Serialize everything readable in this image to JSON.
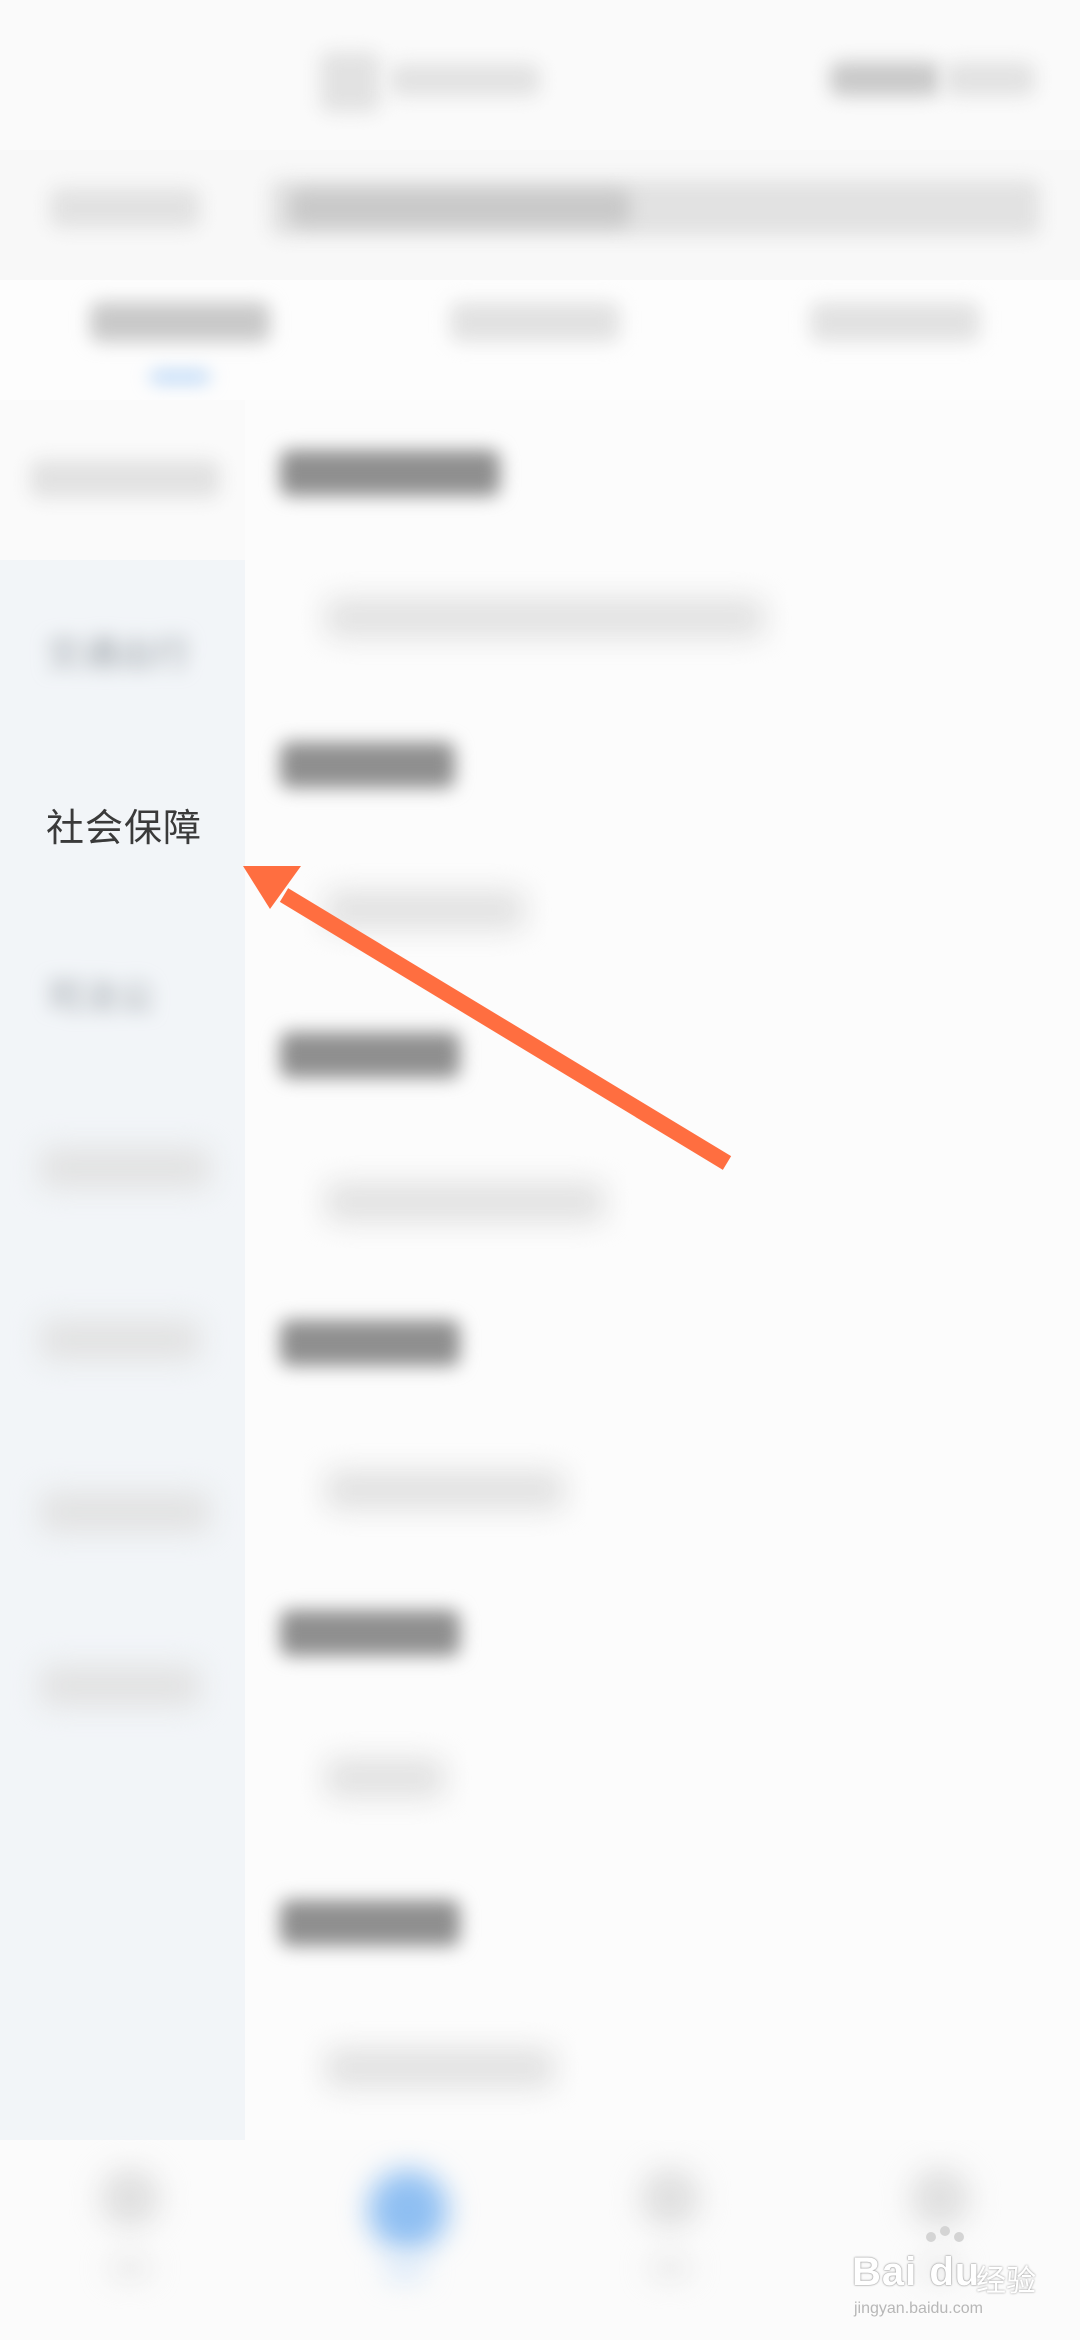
{
  "sidebar": {
    "items": [
      {
        "label": "交通出行"
      },
      {
        "label": "社会保障"
      },
      {
        "label": "司法公"
      }
    ]
  },
  "watermark": {
    "brand": "Bai du",
    "brand_cn": "经验",
    "sub": "jingyan.baidu.com"
  },
  "colors": {
    "arrow": "#ff6e40",
    "tab_underline": "#a9cdf5",
    "nav_active": "#8fbff2"
  }
}
